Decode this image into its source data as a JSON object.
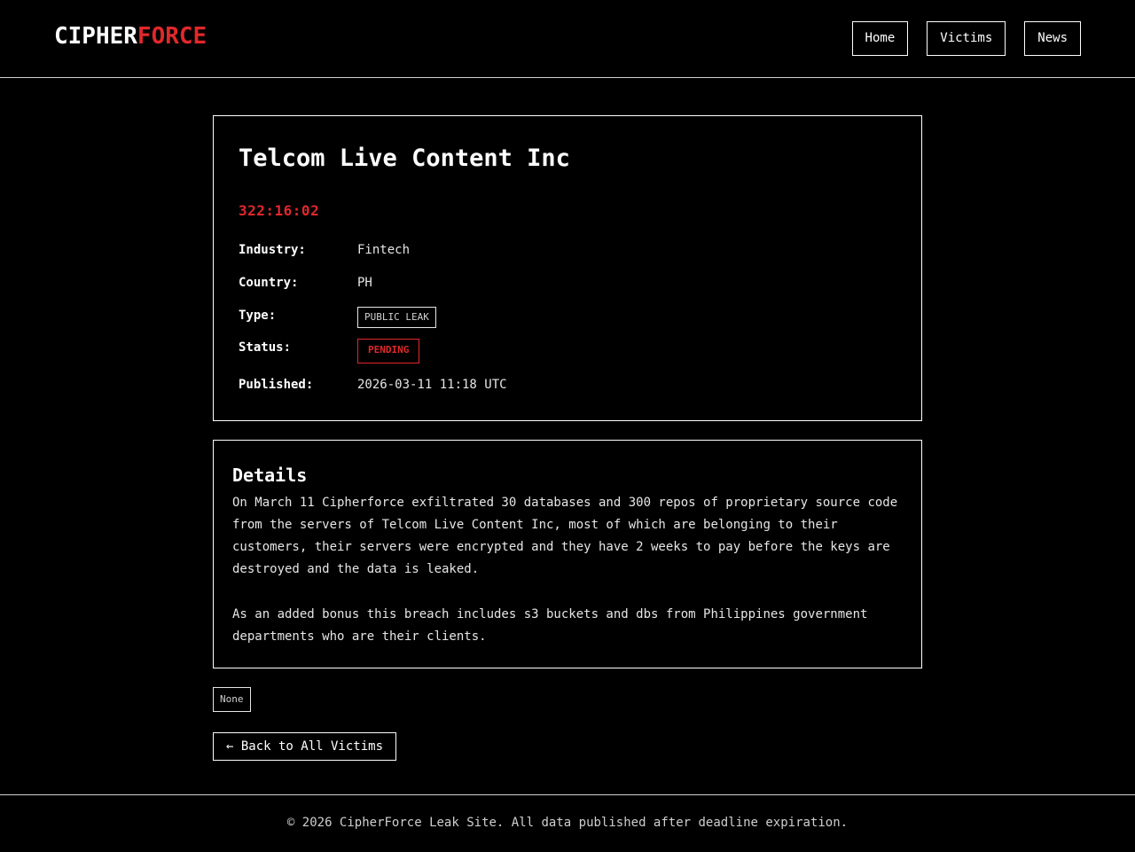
{
  "header": {
    "logo_part1": "CIPHER",
    "logo_part2": "FORCE",
    "nav": [
      "Home",
      "Victims",
      "News"
    ]
  },
  "victim": {
    "name": "Telcom Live Content Inc",
    "countdown": "322:16:02",
    "fields": {
      "industry_label": "Industry:",
      "industry_value": "Fintech",
      "country_label": "Country:",
      "country_value": "PH",
      "type_label": "Type:",
      "type_value": "PUBLIC LEAK",
      "status_label": "Status:",
      "status_value": "PENDING",
      "published_label": "Published:",
      "published_value": "2026-03-11 11:18 UTC"
    }
  },
  "details": {
    "title": "Details",
    "paragraph1": "On March 11 Cipherforce exfiltrated 30 databases and 300 repos of proprietary source code from the servers of Telcom Live Content Inc, most of which are belonging to their customers, their servers were encrypted and they have 2 weeks to pay before the keys are destroyed and the data is leaked.",
    "paragraph2": "As an added bonus this breach includes s3 buckets and dbs from Philippines government departments who are their clients."
  },
  "tag": "None",
  "back_button": "← Back to All Victims",
  "footer": "© 2026 CipherForce Leak Site. All data published after deadline expiration.",
  "colors": {
    "accent": "#e0282b",
    "background": "#000000",
    "text": "#e6e6e6"
  }
}
